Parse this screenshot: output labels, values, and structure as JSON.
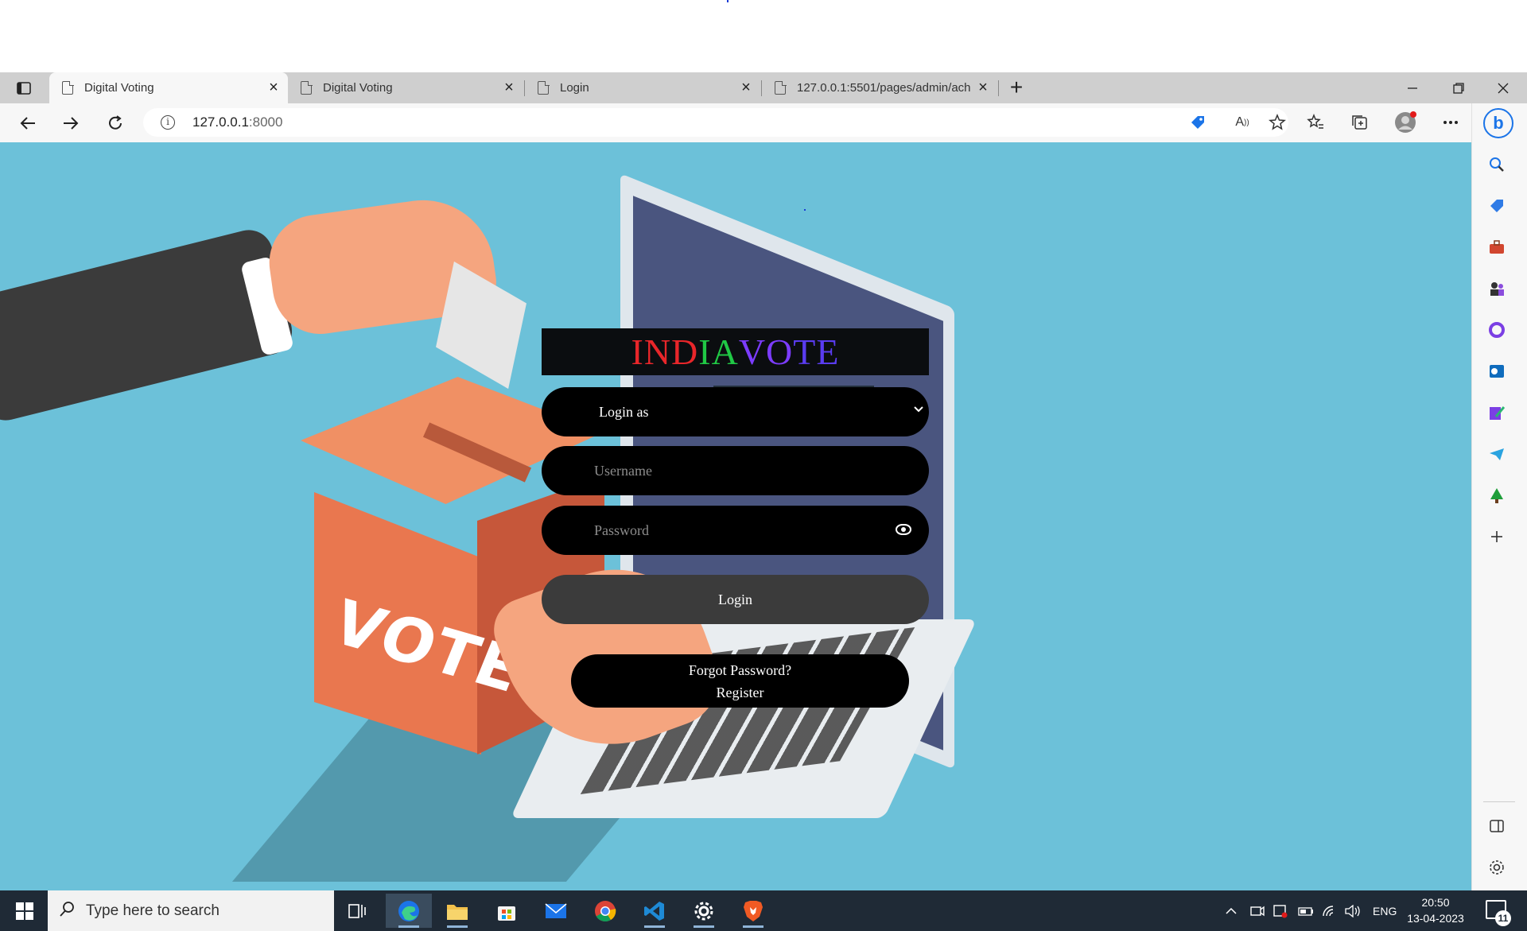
{
  "browser": {
    "tabs": [
      {
        "label": "Digital Voting",
        "active": true
      },
      {
        "label": "Digital Voting",
        "active": false
      },
      {
        "label": "Login",
        "active": false
      },
      {
        "label": "127.0.0.1:5501/pages/admin/ach",
        "active": false
      }
    ],
    "url": {
      "host": "127.0.0.1",
      "port": ":8000"
    },
    "tab_close_glyph": "×",
    "new_tab_glyph": "+"
  },
  "login": {
    "brand_parts": [
      "IND",
      "IA",
      "VO",
      "TE"
    ],
    "brand_colors": [
      "#e8262a",
      "#20c845",
      "#7c3cff",
      "#5a3cf0"
    ],
    "login_as_label": "Login as",
    "username_placeholder": "Username",
    "password_placeholder": "Password",
    "login_button": "Login",
    "forgot_password": "Forgot Password?",
    "register": "Register"
  },
  "illustration": {
    "ballot_text": "VOTE"
  },
  "taskbar": {
    "search_placeholder": "Type here to search",
    "language": "ENG",
    "time": "20:50",
    "date": "13-04-2023",
    "notification_count": "11"
  },
  "colors": {
    "page_background": "#6cc1d9",
    "input_background": "#000000",
    "login_button_background": "#3b3b3b"
  }
}
